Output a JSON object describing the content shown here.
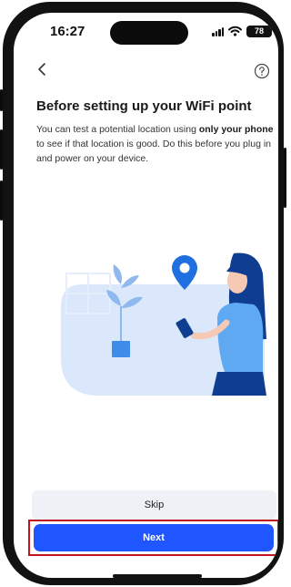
{
  "status_bar": {
    "time": "16:27",
    "battery_level": "78",
    "icons": [
      "cellular-signal-icon",
      "wifi-icon",
      "battery-icon"
    ]
  },
  "header": {
    "back_icon": "chevron-left-icon",
    "help_icon": "question-mark-circle-icon"
  },
  "content": {
    "title": "Before setting up your WiFi point",
    "description": {
      "part1": "You can test a potential location using ",
      "bold": "only your phone",
      "part2": " to see if that location is good. Do this before you plug in and power on your device."
    },
    "illustration": "person-holding-phone-with-location-pin-illustration"
  },
  "actions": {
    "skip_label": "Skip",
    "next_label": "Next"
  },
  "colors": {
    "primary": "#1f56ff",
    "skip_bg": "#eef1f6",
    "highlight": "#c0141f",
    "illustration_light": "#dbe8fb",
    "illustration_blue": "#3f8bea",
    "illustration_navy": "#0f3d8f"
  }
}
